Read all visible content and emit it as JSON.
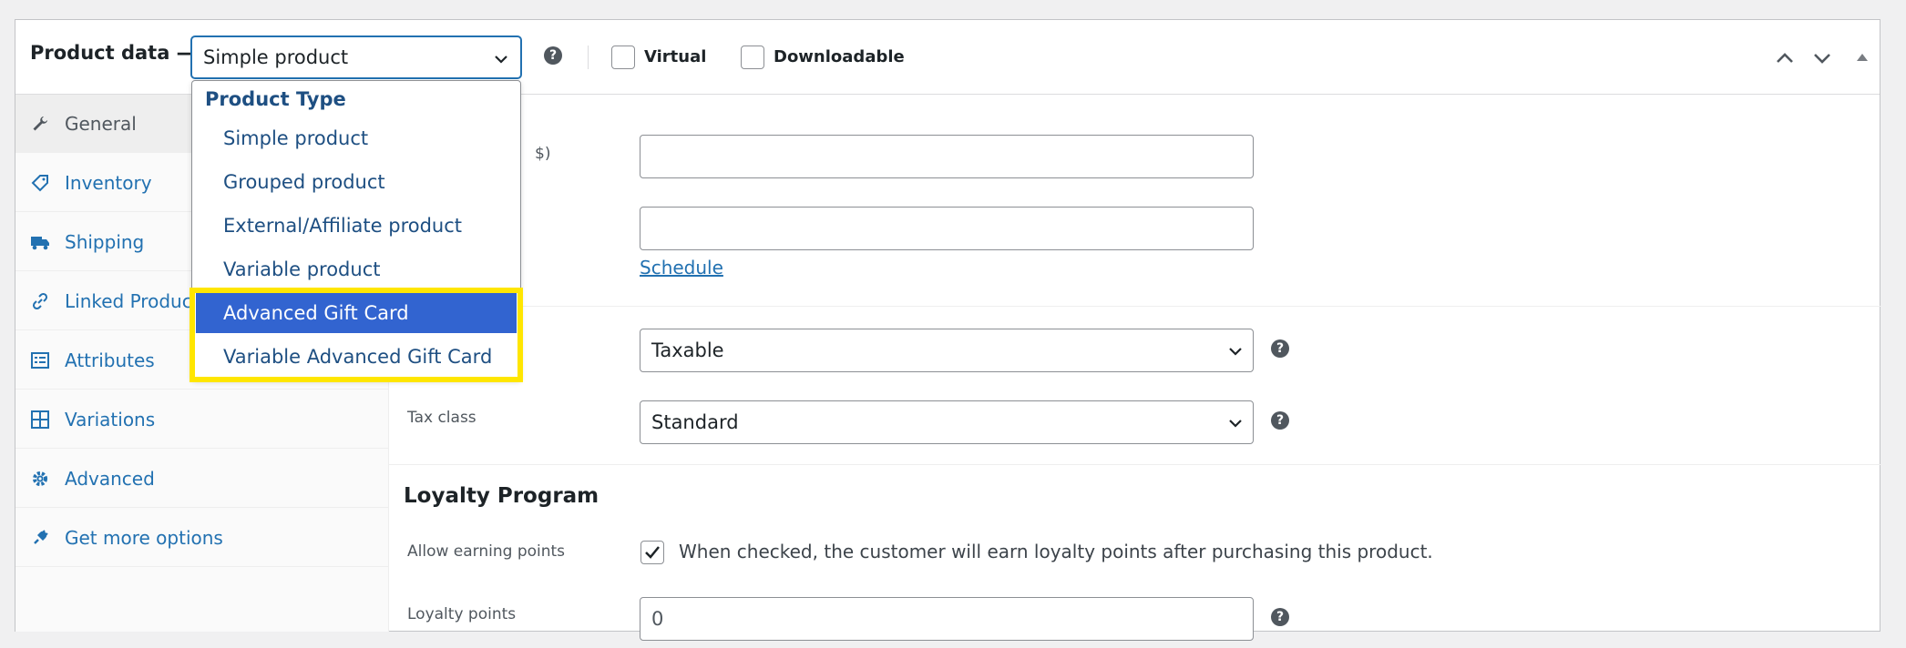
{
  "header": {
    "label": "Product data —",
    "product_type_value": "Simple product",
    "virtual_label": "Virtual",
    "downloadable_label": "Downloadable"
  },
  "dropdown": {
    "group_label": "Product Type",
    "options": [
      "Simple product",
      "Grouped product",
      "External/Affiliate product",
      "Variable product",
      "Advanced Gift Card",
      "Variable Advanced Gift Card"
    ],
    "selected": "Advanced Gift Card",
    "highlight_color": "#ffe600",
    "selected_color": "#3264d0"
  },
  "sidebar": {
    "items": [
      {
        "label": "General",
        "icon": "wrench-icon"
      },
      {
        "label": "Inventory",
        "icon": "tag-icon"
      },
      {
        "label": "Shipping",
        "icon": "truck-icon"
      },
      {
        "label": "Linked Products",
        "icon": "link-icon"
      },
      {
        "label": "Attributes",
        "icon": "list-icon"
      },
      {
        "label": "Variations",
        "icon": "grid-icon"
      },
      {
        "label": "Advanced",
        "icon": "gear-icon"
      },
      {
        "label": "Get more options",
        "icon": "plugin-icon"
      }
    ]
  },
  "general": {
    "regular_price_label_fragment": "$)",
    "regular_price_value": "",
    "sale_price_value": "",
    "schedule_link": "Schedule",
    "tax_status_value": "Taxable",
    "tax_class_label": "Tax class",
    "tax_class_value": "Standard"
  },
  "loyalty": {
    "title": "Loyalty Program",
    "allow_label": "Allow earning points",
    "allow_checked": true,
    "allow_desc": "When checked, the customer will earn loyalty points after purchasing this product.",
    "points_label": "Loyalty points",
    "points_value": "0"
  },
  "colors": {
    "link": "#2271b1",
    "accent": "#2271b1"
  }
}
